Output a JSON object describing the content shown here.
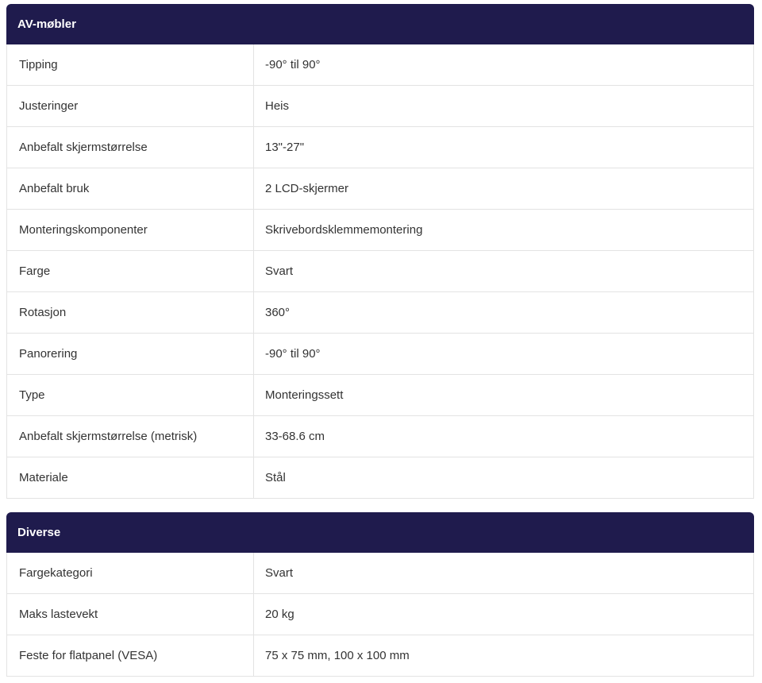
{
  "sections": [
    {
      "title": "AV-møbler",
      "rows": [
        {
          "label": "Tipping",
          "value": "-90° til 90°"
        },
        {
          "label": "Justeringer",
          "value": "Heis"
        },
        {
          "label": "Anbefalt skjermstørrelse",
          "value": "13\"-27\""
        },
        {
          "label": "Anbefalt bruk",
          "value": "2 LCD-skjermer"
        },
        {
          "label": "Monteringskomponenter",
          "value": "Skrivebordsklemmemontering"
        },
        {
          "label": "Farge",
          "value": "Svart"
        },
        {
          "label": "Rotasjon",
          "value": "360°"
        },
        {
          "label": "Panorering",
          "value": "-90° til 90°"
        },
        {
          "label": "Type",
          "value": "Monteringssett"
        },
        {
          "label": "Anbefalt skjermstørrelse (metrisk)",
          "value": "33-68.6 cm"
        },
        {
          "label": "Materiale",
          "value": "Stål"
        }
      ]
    },
    {
      "title": "Diverse",
      "rows": [
        {
          "label": "Fargekategori",
          "value": "Svart"
        },
        {
          "label": "Maks lastevekt",
          "value": "20 kg"
        },
        {
          "label": "Feste for flatpanel (VESA)",
          "value": "75 x 75 mm, 100 x 100 mm"
        }
      ]
    }
  ],
  "colors": {
    "header_bg": "#1f1b4d",
    "header_text": "#ffffff",
    "border": "#e3e3e3",
    "text": "#333333"
  }
}
